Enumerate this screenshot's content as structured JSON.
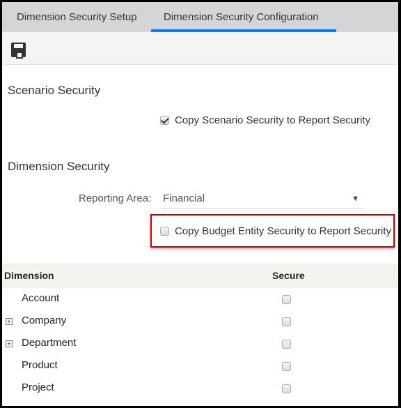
{
  "tabs": [
    {
      "label": "Dimension Security Setup",
      "active": false
    },
    {
      "label": "Dimension Security Configuration",
      "active": true
    }
  ],
  "toolbar": {
    "save_icon": "save-icon"
  },
  "scenario": {
    "title": "Scenario Security",
    "copy_label": "Copy Scenario Security to Report Security",
    "copy_checked": true
  },
  "dimension": {
    "title": "Dimension Security",
    "reporting_area_label": "Reporting Area:",
    "reporting_area_value": "Financial",
    "copy_budget_label": "Copy Budget Entity Security to Report Security",
    "copy_budget_checked": false
  },
  "table": {
    "headers": [
      "Dimension",
      "Secure"
    ],
    "rows": [
      {
        "name": "Account",
        "expandable": false,
        "secure": false
      },
      {
        "name": "Company",
        "expandable": true,
        "secure": false
      },
      {
        "name": "Department",
        "expandable": true,
        "secure": false
      },
      {
        "name": "Product",
        "expandable": false,
        "secure": false
      },
      {
        "name": "Project",
        "expandable": false,
        "secure": false
      }
    ]
  },
  "colors": {
    "active_tab": "#0a7cf0",
    "highlight": "#cc0000"
  }
}
